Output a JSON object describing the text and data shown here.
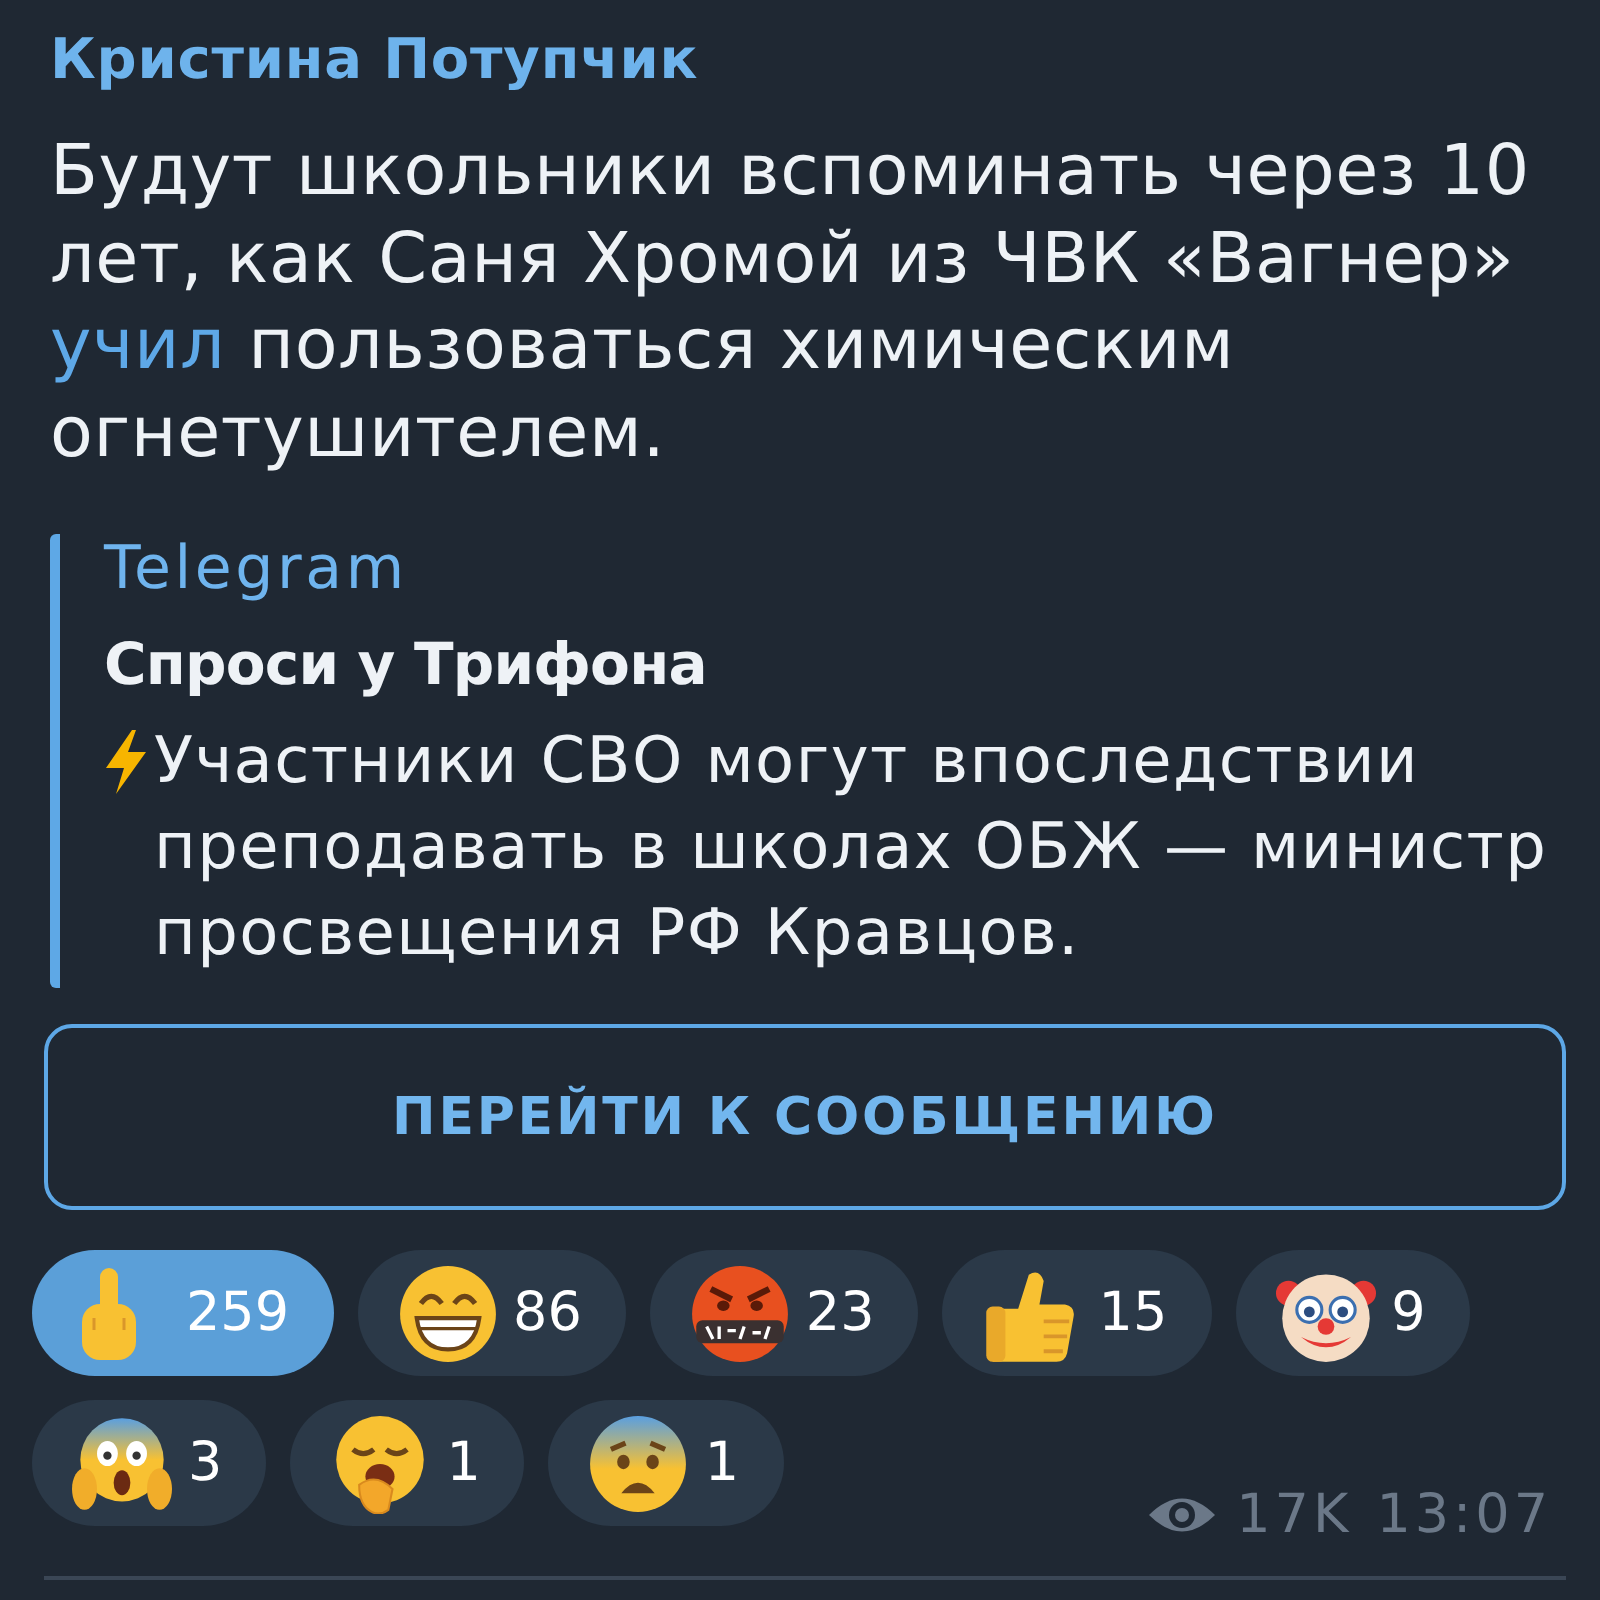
{
  "message": {
    "sender": "Кристина Потупчик",
    "text": [
      {
        "kind": "plain",
        "text": "Будут школьники вспоминать через 10 лет, как Саня Хромой из ЧВК «Вагнер» "
      },
      {
        "kind": "link",
        "text": "учил"
      },
      {
        "kind": "plain",
        "text": " пользоваться химическим огнетушителем."
      }
    ]
  },
  "quote": {
    "source": "Telegram",
    "title": "Спроси у Трифона",
    "text": "Участники СВО могут впоследствии преподавать в школах ОБЖ — министр просвещения РФ Кравцов."
  },
  "button": {
    "label": "ПЕРЕЙТИ К СООБЩЕНИЮ"
  },
  "reactions": [
    {
      "kind": "finger",
      "count": "259",
      "selected": true
    },
    {
      "kind": "grin",
      "count": "86",
      "selected": false
    },
    {
      "kind": "cursing",
      "count": "23",
      "selected": false
    },
    {
      "kind": "thumbsup",
      "count": "15",
      "selected": false
    },
    {
      "kind": "clown",
      "count": "9",
      "selected": false
    },
    {
      "kind": "scream",
      "count": "3",
      "selected": false
    },
    {
      "kind": "yawn",
      "count": "1",
      "selected": false
    },
    {
      "kind": "fearful",
      "count": "1",
      "selected": false
    }
  ],
  "meta": {
    "views": "17K",
    "time": "13:07"
  }
}
